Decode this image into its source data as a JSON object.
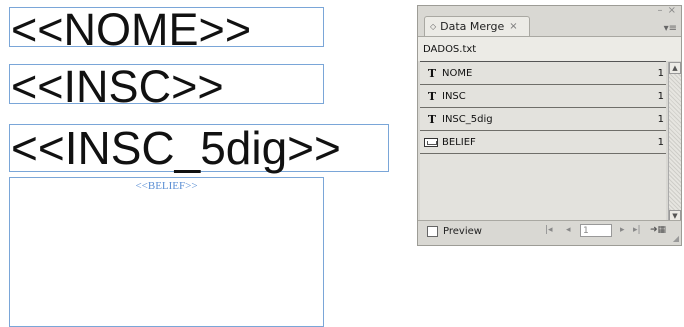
{
  "canvas": {
    "frames": [
      {
        "text": "<<NOME>>"
      },
      {
        "text": "<<INSC>>"
      },
      {
        "text": "<<INSC_5dig>>"
      },
      {
        "text": "<<BELIEF>>"
      }
    ]
  },
  "panel": {
    "tab_label": "Data Merge",
    "close_glyph": "×",
    "window_controls": "– ×",
    "menu_glyph": "▾≡",
    "source_file": "DADOS.txt",
    "fields": [
      {
        "type_icon": "T",
        "name": "NOME",
        "count": "1"
      },
      {
        "type_icon": "T",
        "name": "INSC",
        "count": "1"
      },
      {
        "type_icon": "T",
        "name": "INSC_5dig",
        "count": "1"
      },
      {
        "type_icon": "image-field-icon",
        "name": "BELIEF",
        "count": "1"
      }
    ],
    "preview_label": "Preview",
    "record_value": "1",
    "nav": {
      "first": "|◂",
      "prev": "◂",
      "next": "▸",
      "last": "▸|",
      "goto": "➜▦"
    }
  }
}
